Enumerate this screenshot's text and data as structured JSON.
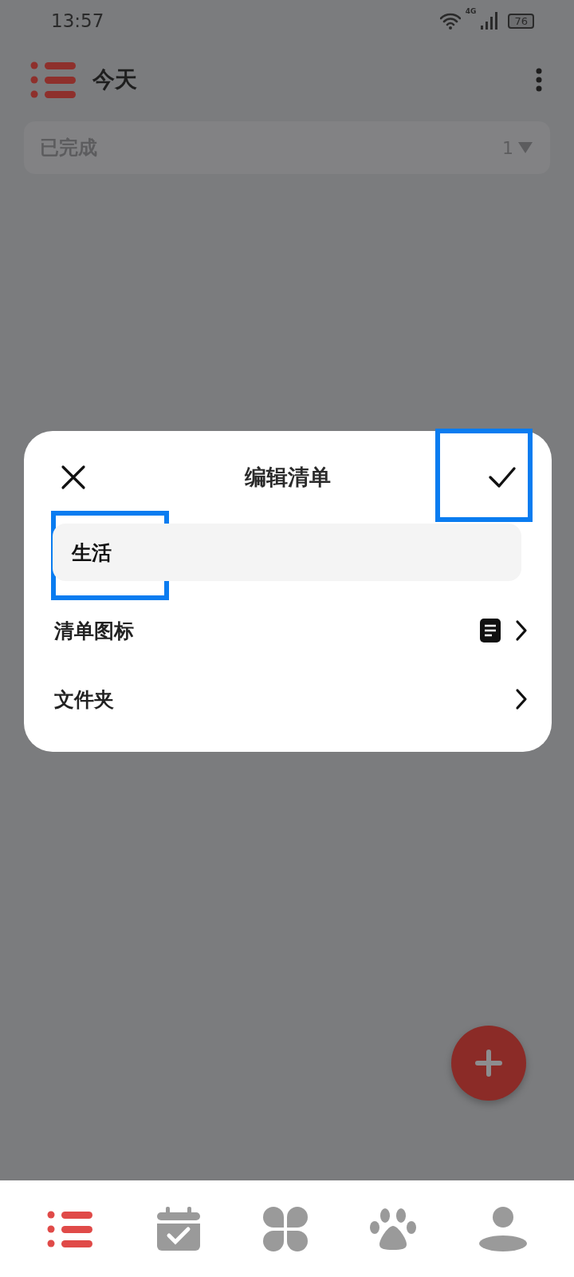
{
  "status_bar": {
    "time": "13:57",
    "network": "4G",
    "battery": "76"
  },
  "header": {
    "title": "今天"
  },
  "completed_section": {
    "label": "已完成",
    "count": "1",
    "expanded": false
  },
  "dialog": {
    "title": "编辑清单",
    "confirm_highlighted": true,
    "name_field": {
      "value": "生活",
      "highlighted": true
    },
    "rows": [
      {
        "kind": "icon",
        "label": "清单图标"
      },
      {
        "kind": "plain",
        "label": "文件夹"
      }
    ]
  },
  "bottom_nav": [
    {
      "kind": "list",
      "selected": true
    },
    {
      "kind": "calendar",
      "selected": false
    },
    {
      "kind": "clover",
      "selected": false
    },
    {
      "kind": "paw",
      "selected": false
    },
    {
      "kind": "person",
      "selected": false
    }
  ]
}
